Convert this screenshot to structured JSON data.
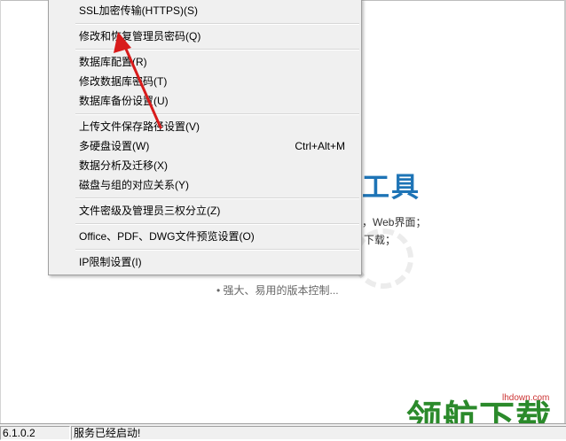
{
  "menu": {
    "items": [
      {
        "label": "SSL加密传输(HTTPS)(S)"
      },
      {
        "label": "修改和恢复管理员密码(Q)"
      },
      {
        "label": "数据库配置(R)"
      },
      {
        "label": "修改数据库密码(T)"
      },
      {
        "label": "数据库备份设置(U)"
      },
      {
        "label": "上传文件保存路径设置(V)"
      },
      {
        "label": "多硬盘设置(W)",
        "shortcut": "Ctrl+Alt+M"
      },
      {
        "label": "数据分析及迁移(X)"
      },
      {
        "label": "磁盘与组的对应关系(Y)"
      },
      {
        "label": "文件密级及管理员三权分立(Z)"
      },
      {
        "label": "Office、PDF、DWG文件预览设置(O)"
      },
      {
        "label": "IP限制设置(I)"
      }
    ]
  },
  "splash": {
    "title": "工具",
    "line1": "，Web界面；",
    "line2": "下载；",
    "feature": "• 强大、易用的版本控制..."
  },
  "statusbar": {
    "version": "6.1.0.2",
    "status": "服务已经启动!"
  },
  "watermark": {
    "text": "领航下载",
    "url": "lhdown.com"
  },
  "colors": {
    "arrow": "#d81b1b",
    "title_blue": "#1e74b6",
    "watermark_green": "#2b8a2b"
  }
}
